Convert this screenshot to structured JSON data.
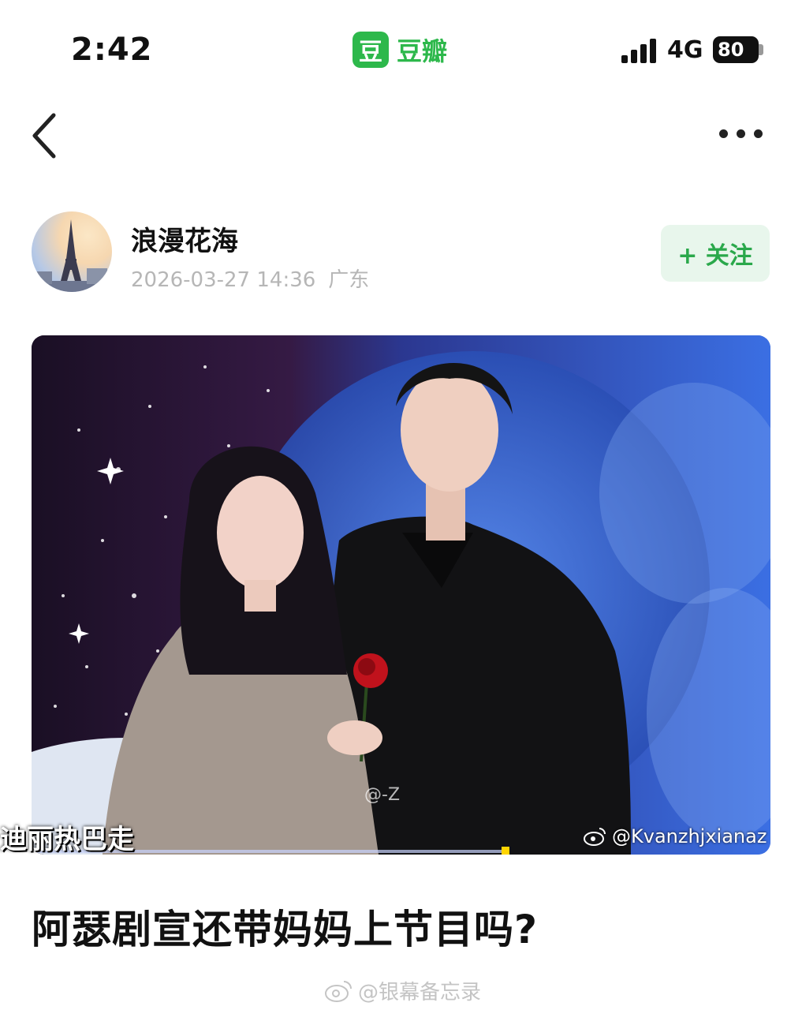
{
  "status_bar": {
    "time": "2:42",
    "app_icon_glyph": "豆",
    "app_name": "豆瓣",
    "network": "4G",
    "battery": "80"
  },
  "nav": {
    "back_icon": "chevron-left-icon",
    "more_icon": "more-horizontal-icon"
  },
  "author": {
    "name": "浪漫花海",
    "timestamp": "2026-03-27 14:36",
    "location": "广东",
    "follow_label": "+ 关注"
  },
  "photo": {
    "caption_left": "迪丽热巴走",
    "watermark_mid": "@-Z",
    "watermark_right": "@Kvanzhjxianaz"
  },
  "post": {
    "title": "阿瑟剧宣还带妈妈上节目吗?"
  },
  "footer": {
    "watermark": "@银幕备忘录"
  },
  "colors": {
    "brand_green": "#2db84b",
    "follow_bg": "#e8f6ec",
    "meta_gray": "#b6b6b6"
  }
}
